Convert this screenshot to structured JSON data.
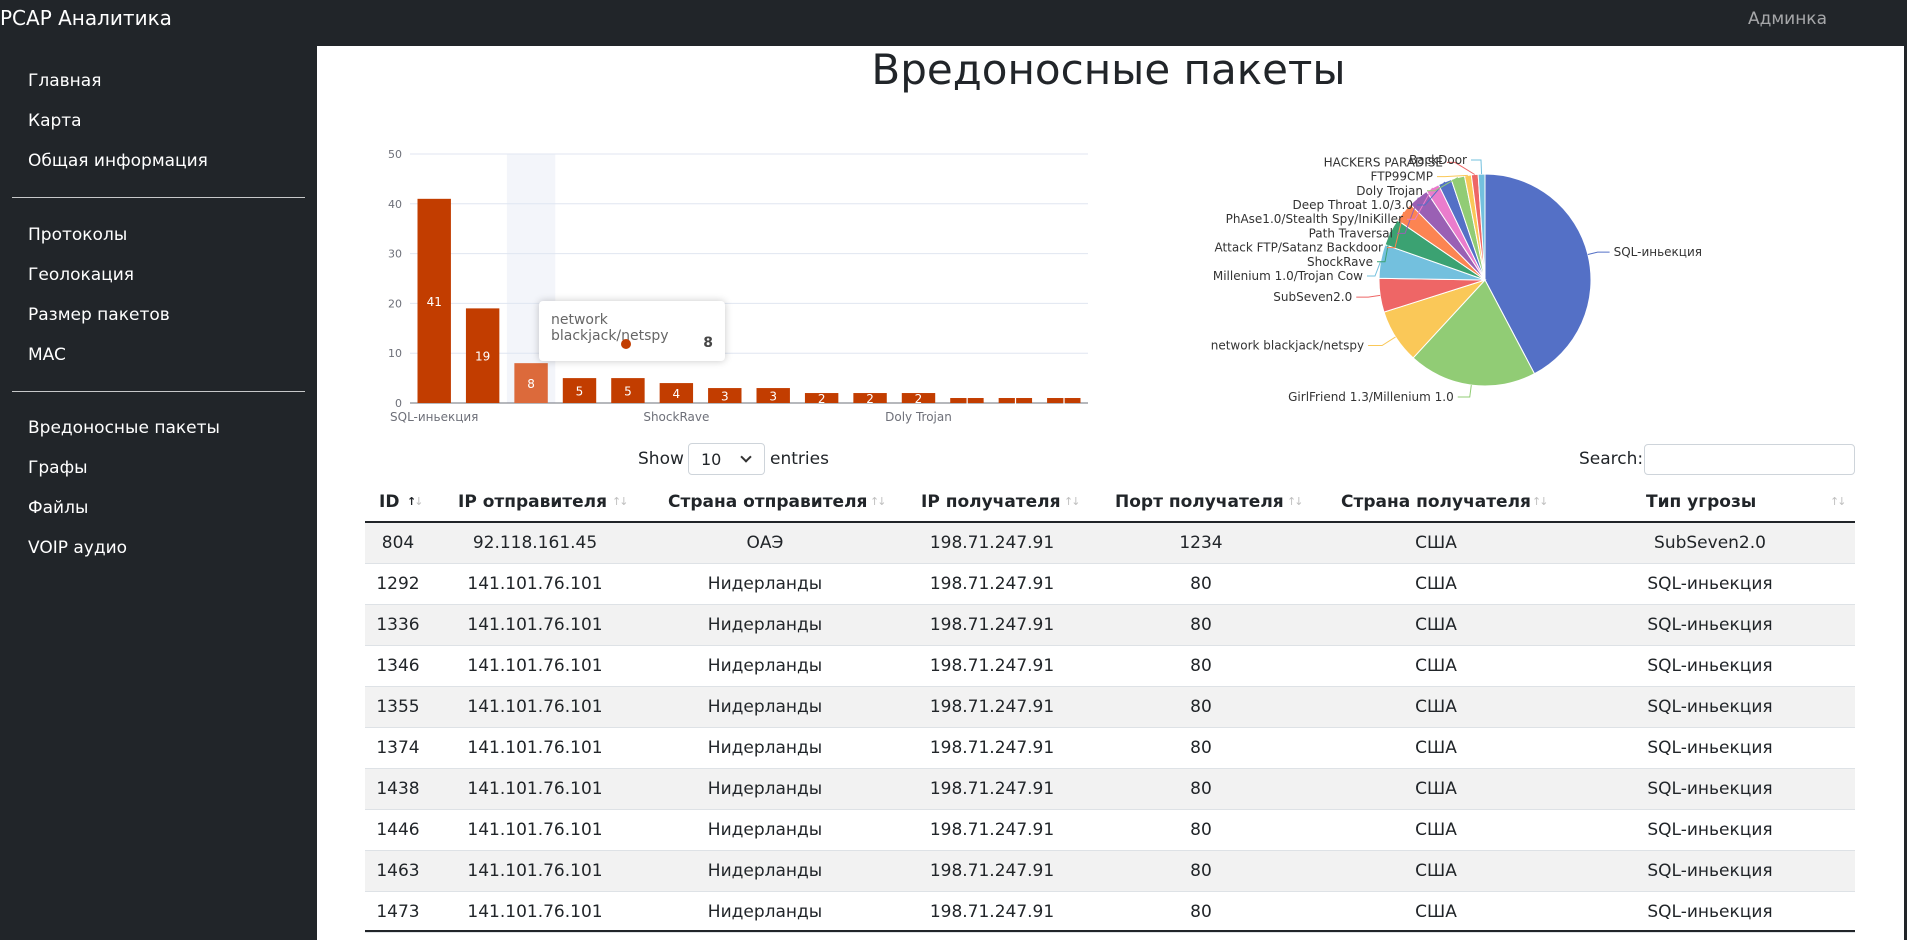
{
  "app": {
    "title": "PCAP Аналитика",
    "user": "Админка"
  },
  "sidebar": {
    "groups": [
      [
        "Главная",
        "Карта",
        "Общая информация"
      ],
      [
        "Протоколы",
        "Геолокация",
        "Размер пакетов",
        "MAC"
      ],
      [
        "Вредоносные пакеты",
        "Графы",
        "Файлы",
        "VOIP аудио"
      ]
    ]
  },
  "page": {
    "title": "Вредоносные пакеты"
  },
  "chart_data": [
    {
      "type": "bar",
      "categories": [
        "SQL-иньекция",
        "GirlFriend 1.3/Millenium 1.0",
        "network blackjack/netspy",
        "SubSeven2.0",
        "Millenium 1.0/Trojan Cow",
        "ShockRave",
        "Attack FTP/Satanz Backdoor",
        "Path Traversal",
        "PhAse1.0/Stealth Spy/IniKiller",
        "Deep Throat 1.0/3.0",
        "Doly Trojan",
        "FTP99CMP",
        "HACKERS PARADISE",
        "BackDoor"
      ],
      "values": [
        41,
        19,
        8,
        5,
        5,
        4,
        3,
        3,
        2,
        2,
        2,
        1,
        1,
        1
      ],
      "visible_x_labels": [
        "SQL-иньекция",
        "ShockRave",
        "Doly Trojan"
      ],
      "ylim": [
        0,
        50
      ],
      "yticks": [
        0,
        10,
        20,
        30,
        40,
        50
      ],
      "color": "#c23d00",
      "highlight_color": "#dc6a3b",
      "highlight_index": 2,
      "tooltip": {
        "name": "network blackjack/netspy",
        "value": "8"
      }
    },
    {
      "type": "pie",
      "labels": [
        "SQL-иньекция",
        "GirlFriend 1.3/Millenium 1.0",
        "network blackjack/netspy",
        "SubSeven2.0",
        "Millenium 1.0/Trojan Cow",
        "ShockRave",
        "Attack FTP/Satanz Backdoor",
        "Path Traversal",
        "PhAse1.0/Stealth Spy/IniKiller",
        "Deep Throat 1.0/3.0",
        "Doly Trojan",
        "FTP99CMP",
        "HACKERS PARADISE",
        "BackDoor"
      ],
      "values": [
        41,
        19,
        8,
        5,
        5,
        4,
        3,
        3,
        2,
        2,
        2,
        1,
        1,
        1
      ],
      "colors": [
        "#5470c6",
        "#91cc75",
        "#fac858",
        "#ee6666",
        "#73c0de",
        "#3ba272",
        "#fc8452",
        "#9a60b4",
        "#ea7ccc",
        "#5470c6",
        "#91cc75",
        "#fac858",
        "#ee6666",
        "#73c0de"
      ]
    }
  ],
  "table": {
    "show_label": "Show",
    "length": "10",
    "entries_label": "entries",
    "search_label": "Search:",
    "columns": [
      "ID",
      "IP отправителя",
      "Страна отправителя",
      "IP получателя",
      "Порт получателя",
      "Страна получателя",
      "Тип угрозы"
    ],
    "rows": [
      [
        "804",
        "92.118.161.45",
        "ОАЭ",
        "198.71.247.91",
        "1234",
        "США",
        "SubSeven2.0"
      ],
      [
        "1292",
        "141.101.76.101",
        "Нидерланды",
        "198.71.247.91",
        "80",
        "США",
        "SQL-иньекция"
      ],
      [
        "1336",
        "141.101.76.101",
        "Нидерланды",
        "198.71.247.91",
        "80",
        "США",
        "SQL-иньекция"
      ],
      [
        "1346",
        "141.101.76.101",
        "Нидерланды",
        "198.71.247.91",
        "80",
        "США",
        "SQL-иньекция"
      ],
      [
        "1355",
        "141.101.76.101",
        "Нидерланды",
        "198.71.247.91",
        "80",
        "США",
        "SQL-иньекция"
      ],
      [
        "1374",
        "141.101.76.101",
        "Нидерланды",
        "198.71.247.91",
        "80",
        "США",
        "SQL-иньекция"
      ],
      [
        "1438",
        "141.101.76.101",
        "Нидерланды",
        "198.71.247.91",
        "80",
        "США",
        "SQL-иньекция"
      ],
      [
        "1446",
        "141.101.76.101",
        "Нидерланды",
        "198.71.247.91",
        "80",
        "США",
        "SQL-иньекция"
      ],
      [
        "1463",
        "141.101.76.101",
        "Нидерланды",
        "198.71.247.91",
        "80",
        "США",
        "SQL-иньекция"
      ],
      [
        "1473",
        "141.101.76.101",
        "Нидерланды",
        "198.71.247.91",
        "80",
        "США",
        "SQL-иньекция"
      ]
    ]
  }
}
